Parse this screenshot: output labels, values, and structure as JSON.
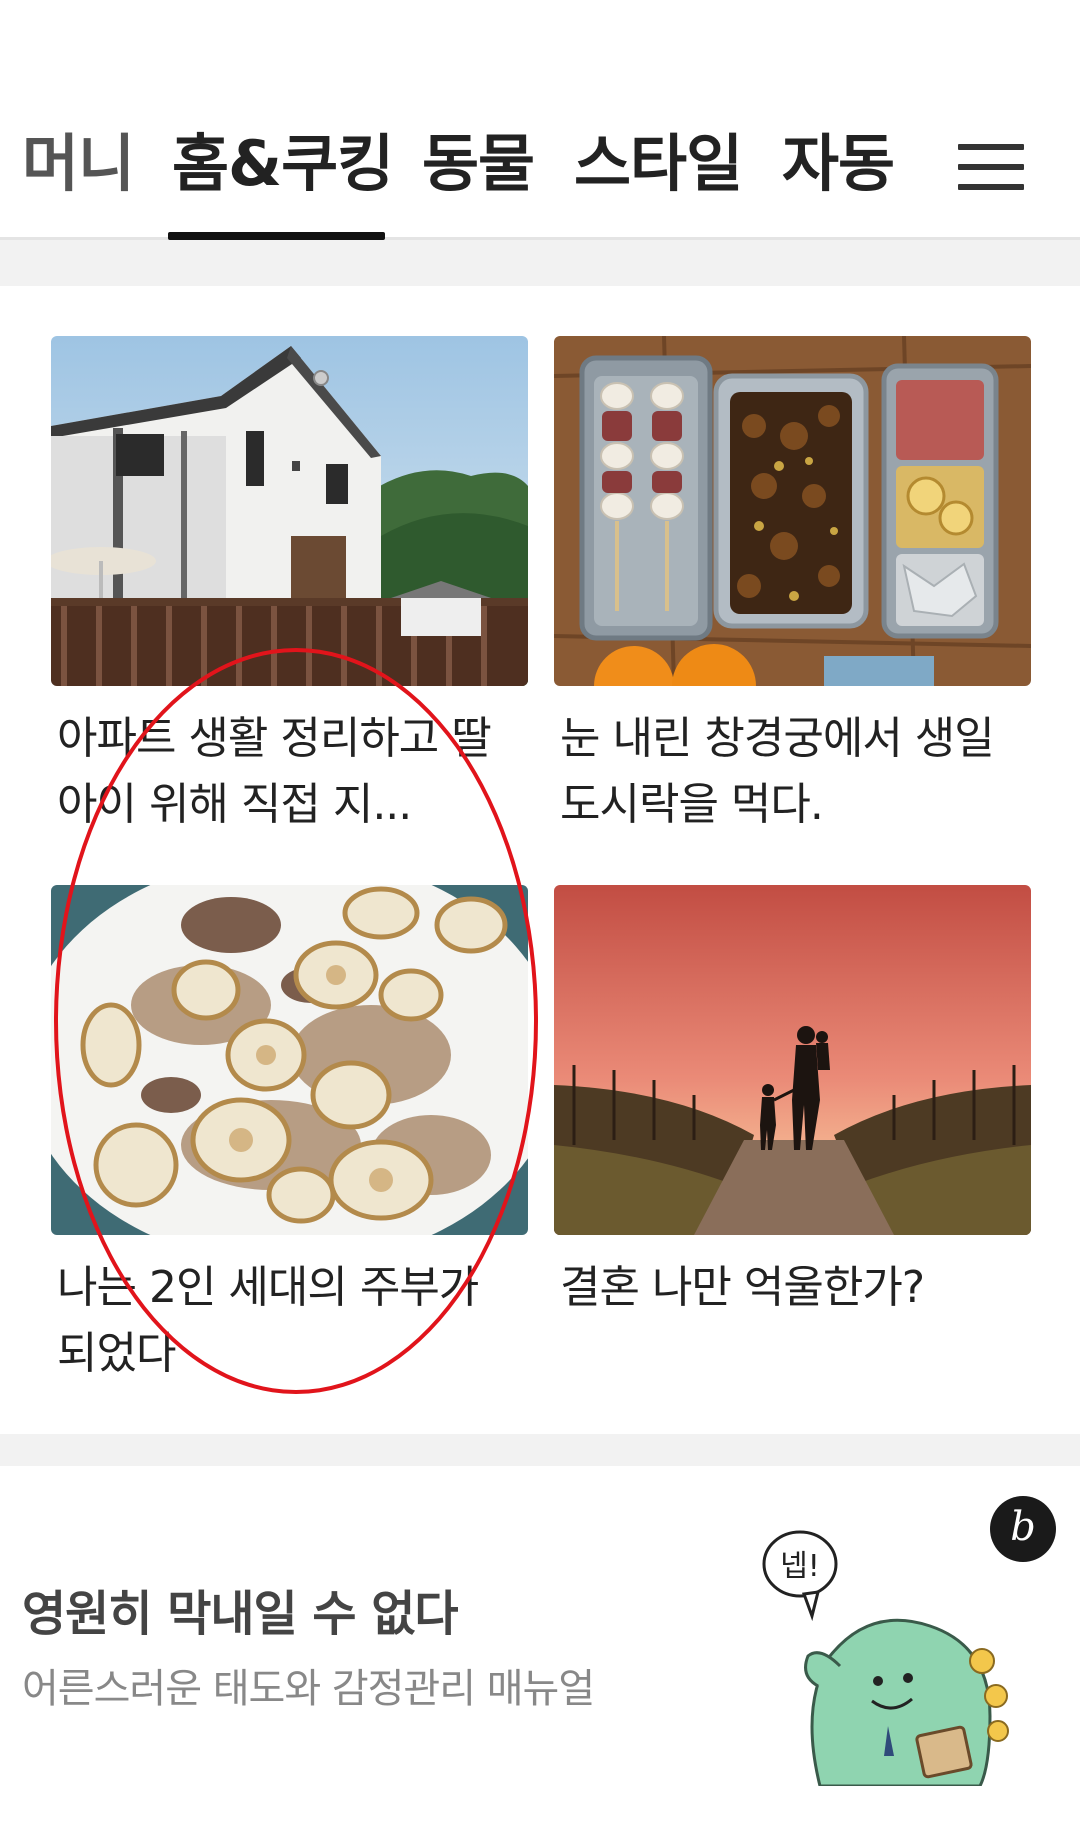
{
  "tabs": {
    "items": [
      {
        "label": "머니"
      },
      {
        "label": "홈&쿠킹"
      },
      {
        "label": "동물"
      },
      {
        "label": "스타일"
      },
      {
        "label": "자동"
      }
    ],
    "active": "홈&쿠킹"
  },
  "cards": [
    {
      "title": "아파트 생활 정리하고 딸 아이 위해 직접 지..."
    },
    {
      "title": "눈 내린 창경궁에서 생일 도시락을 먹다."
    },
    {
      "title": "나는 2인 세대의 주부가 되었다"
    },
    {
      "title": "결혼 나만 억울한가?"
    }
  ],
  "banner": {
    "title": "영원히 막내일 수 없다",
    "subtitle": "어른스러운 태도와 감정관리 매뉴얼",
    "speech_bubble": "넵!",
    "logo_glyph": "b"
  },
  "colors": {
    "highlight": "#e1141b",
    "mascot": "#8fd4b0"
  }
}
